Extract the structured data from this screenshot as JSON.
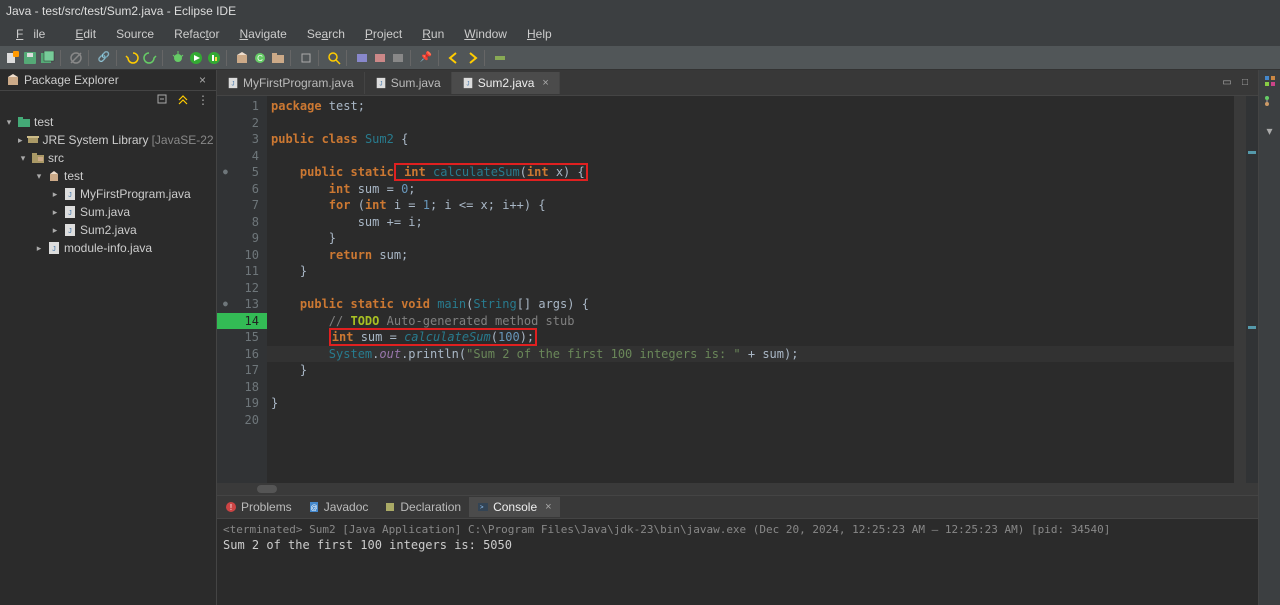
{
  "window": {
    "title": "Java - test/src/test/Sum2.java - Eclipse IDE"
  },
  "menu": {
    "file": "File",
    "edit": "Edit",
    "source": "Source",
    "refactor": "Refactor",
    "navigate": "Navigate",
    "search": "Search",
    "project": "Project",
    "run": "Run",
    "window": "Window",
    "help": "Help"
  },
  "explorer": {
    "title": "Package Explorer",
    "project": "test",
    "jre": "JRE System Library",
    "jre_ver": "[JavaSE-22",
    "src": "src",
    "pkg": "test",
    "files": [
      "MyFirstProgram.java",
      "Sum.java",
      "Sum2.java"
    ],
    "module": "module-info.java"
  },
  "tabs": {
    "t1": "MyFirstProgram.java",
    "t2": "Sum.java",
    "t3": "Sum2.java"
  },
  "code": {
    "l1a": "package",
    "l1b": " test;",
    "l3a": "public",
    "l3b": " class",
    "l3c": " Sum2",
    "l3d": " {",
    "l5a": "public",
    "l5b": " static",
    "l5c": " int",
    "l5d": " calculateSum",
    "l5e": "(",
    "l5f": "int",
    "l5g": " x) {",
    "l6a": "int",
    "l6b": " sum = ",
    "l6c": "0",
    "l6d": ";",
    "l7a": "for",
    "l7b": " (",
    "l7c": "int",
    "l7d": " i = ",
    "l7e": "1",
    "l7f": "; i <= x; i++) {",
    "l8a": "sum += i;",
    "l9a": "}",
    "l10a": "return",
    "l10b": " sum;",
    "l11a": "}",
    "l13a": "public",
    "l13b": " static",
    "l13c": " void",
    "l13d": " main",
    "l13e": "(",
    "l13f": "String",
    "l13g": "[] args) {",
    "l14a": "// ",
    "l14b": "TODO",
    "l14c": " Auto-generated method stub",
    "l15a": "int",
    "l15b": " sum = ",
    "l15c": "calculateSum",
    "l15d": "(",
    "l15e": "100",
    "l15f": ");",
    "l16a": "System",
    "l16b": ".",
    "l16c": "out",
    "l16d": ".println(",
    "l16e": "\"Sum 2 of the first 100 integers is: \"",
    "l16f": " + sum);",
    "l17a": "}",
    "l19a": "}",
    "lines": [
      "1",
      "2",
      "3",
      "4",
      "5",
      "6",
      "7",
      "8",
      "9",
      "10",
      "11",
      "12",
      "13",
      "14",
      "15",
      "16",
      "17",
      "18",
      "19",
      "20"
    ]
  },
  "bottom_tabs": {
    "problems": "Problems",
    "javadoc": "Javadoc",
    "declaration": "Declaration",
    "console": "Console"
  },
  "console": {
    "status": "<terminated> Sum2 [Java Application] C:\\Program Files\\Java\\jdk-23\\bin\\javaw.exe  (Dec 20, 2024, 12:25:23 AM – 12:25:23 AM) [pid: 34540]",
    "out": "Sum 2 of the first 100 integers is: 5050"
  }
}
